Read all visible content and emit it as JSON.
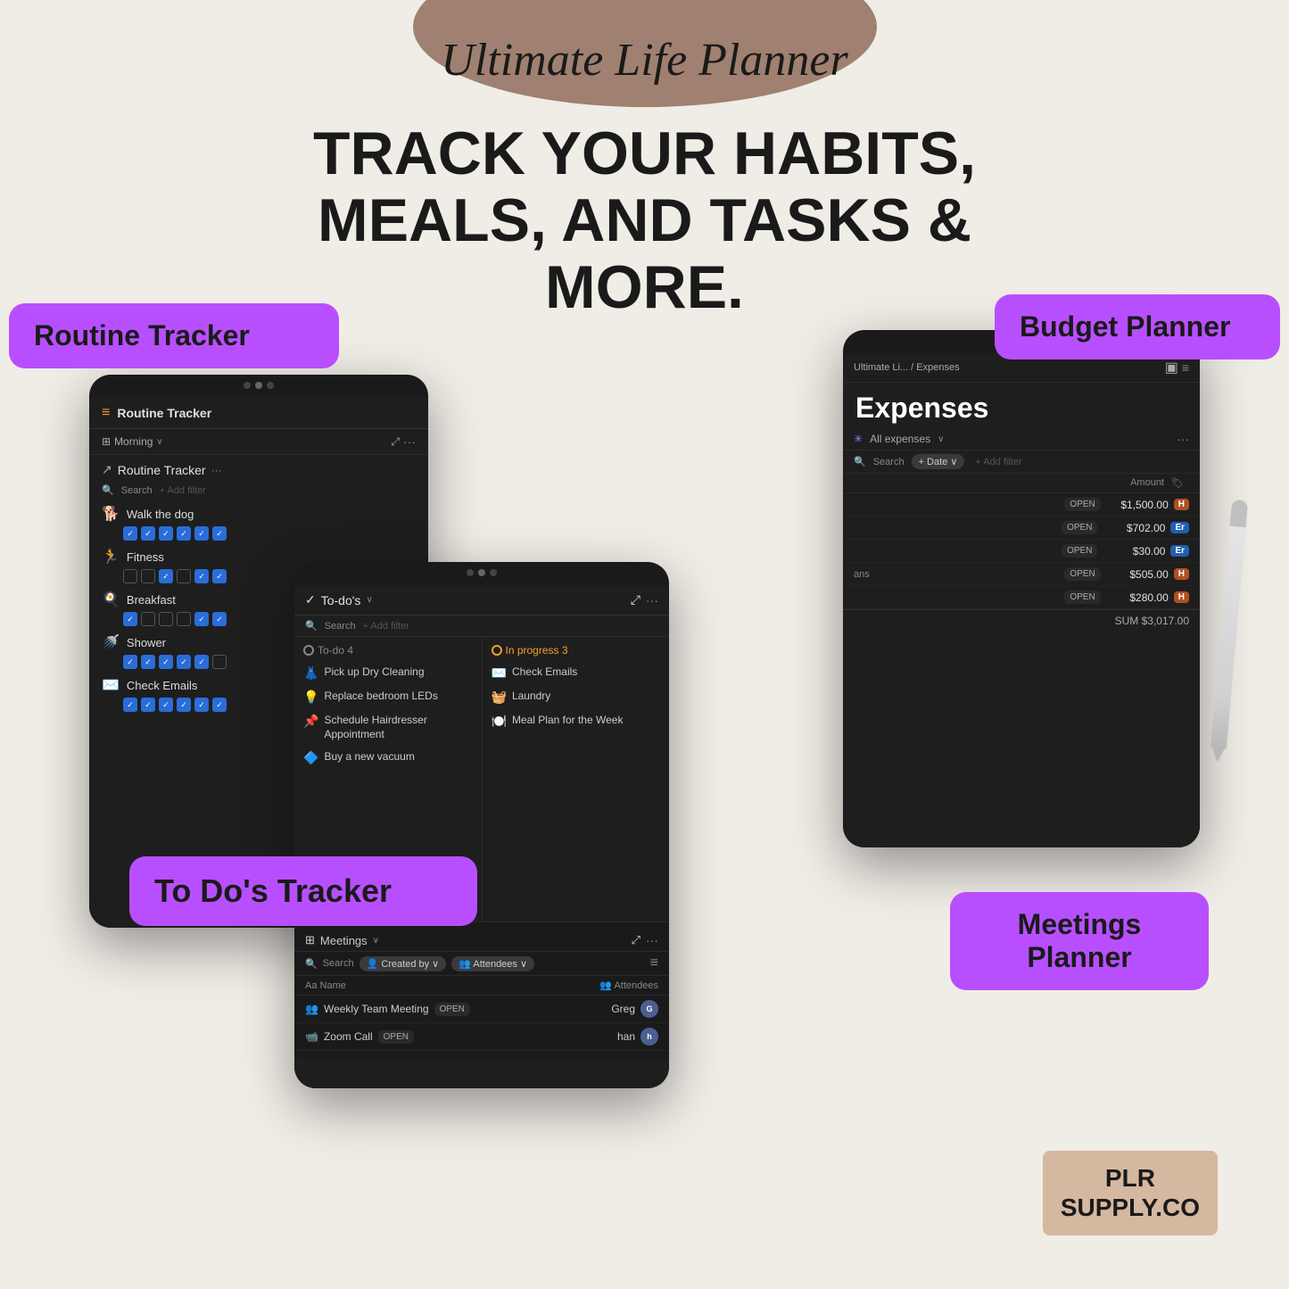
{
  "page": {
    "title": "Ultimate Life Planner",
    "tagline": "TRACK YOUR HABITS, MEALS, AND TASKS & MORE.",
    "background_color": "#f0ece6"
  },
  "badges": {
    "routine": "Routine Tracker",
    "budget": "Budget Planner",
    "todo": "To Do's Tracker",
    "meetings": "Meetings Planner"
  },
  "routine_tracker": {
    "title": "Routine Tracker",
    "section": "Morning",
    "page_title": "↗ Routine Tracker",
    "search_placeholder": "Search",
    "add_filter": "+ Add filter",
    "items": [
      {
        "emoji": "🐕",
        "name": "Walk the dog",
        "checks": [
          true,
          true,
          true,
          true,
          true,
          true
        ]
      },
      {
        "emoji": "🏃",
        "name": "Fitness",
        "checks": [
          false,
          false,
          true,
          false,
          true,
          true
        ]
      },
      {
        "emoji": "🍳",
        "name": "Breakfast",
        "checks": [
          true,
          false,
          false,
          false,
          true,
          true
        ]
      },
      {
        "emoji": "🚿",
        "name": "Shower",
        "checks": [
          true,
          true,
          true,
          true,
          true,
          false
        ]
      },
      {
        "emoji": "✉️",
        "name": "Check Emails",
        "checks": [
          true,
          true,
          true,
          true,
          true,
          true
        ]
      }
    ]
  },
  "expenses": {
    "breadcrumb": "Ultimate Li... / Expenses",
    "title": "Expenses",
    "filter_label": "All expenses",
    "date_label": "Date",
    "add_filter": "+ Add filter",
    "search_placeholder": "Search",
    "col_amount": "Amount",
    "rows": [
      {
        "status": "OPEN",
        "amount": "$1,500.00",
        "tag": "H",
        "tag_class": "tag-h"
      },
      {
        "status": "OPEN",
        "amount": "$702.00",
        "tag": "Er",
        "tag_class": "tag-e"
      },
      {
        "status": "OPEN",
        "amount": "$30.00",
        "tag": "Er",
        "tag_class": "tag-e"
      },
      {
        "status": "OPEN",
        "amount": "$505.00",
        "tag": "H",
        "tag_class": "tag-h"
      },
      {
        "status": "OPEN",
        "amount": "$280.00",
        "tag": "H",
        "tag_class": "tag-h"
      }
    ],
    "sum_label": "SUM $3,017.00"
  },
  "todos": {
    "header": "To-do's",
    "search_placeholder": "Search",
    "add_filter": "+ Add filter",
    "col_todo": "To-do  4",
    "col_in_progress": "In progress  3",
    "todo_items": [
      {
        "emoji": "👗",
        "text": "Pick up Dry Cleaning"
      },
      {
        "emoji": "💡",
        "text": "Replace bedroom LEDs"
      },
      {
        "emoji": "📌",
        "text": "Schedule Hairdresser Appointment"
      },
      {
        "emoji": "🔷",
        "text": "Buy a new vacuum"
      }
    ],
    "in_progress_items": [
      {
        "emoji": "✉️",
        "text": "Check Emails"
      },
      {
        "emoji": "🧺",
        "text": "Laundry"
      },
      {
        "emoji": "🍽️",
        "text": "Meal Plan for the Week"
      }
    ]
  },
  "meetings": {
    "header": "Meetings",
    "search_placeholder": "Search",
    "created_by": "Created by",
    "attendees": "Attendees",
    "col_name": "Aa Name",
    "col_attendees": "Attendees",
    "rows": [
      {
        "emoji": "👥",
        "name": "Weekly Team Meeting",
        "status": "OPEN",
        "attendee": "Greg",
        "avatar": "G"
      },
      {
        "emoji": "📹",
        "name": "Zoom Call",
        "status": "OPEN",
        "attendee": "han",
        "avatar": "h"
      }
    ]
  },
  "plr": {
    "line1": "PLR",
    "line2": "SUPPLY.CO"
  }
}
